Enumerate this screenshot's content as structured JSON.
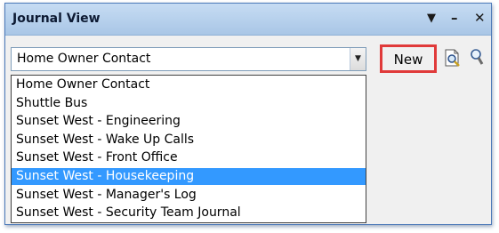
{
  "window": {
    "title": "Journal View",
    "controls": {
      "dropdown": "▼",
      "minimize": "–",
      "close": "✕"
    }
  },
  "combo": {
    "value": "Home Owner Contact",
    "arrow": "▼"
  },
  "toolbar": {
    "new_label": "New"
  },
  "dropdown": {
    "selected_index": 5,
    "items": [
      "Home Owner Contact",
      "Shuttle Bus",
      "Sunset West - Engineering",
      "Sunset West - Wake Up Calls",
      "Sunset West - Front Office",
      "Sunset West - Housekeeping",
      "Sunset West - Manager's Log",
      "Sunset West - Security Team Journal"
    ]
  },
  "colors": {
    "highlight": "#3399ff",
    "callout": "#e03a3a",
    "titlebar": "#b7cfe9"
  }
}
